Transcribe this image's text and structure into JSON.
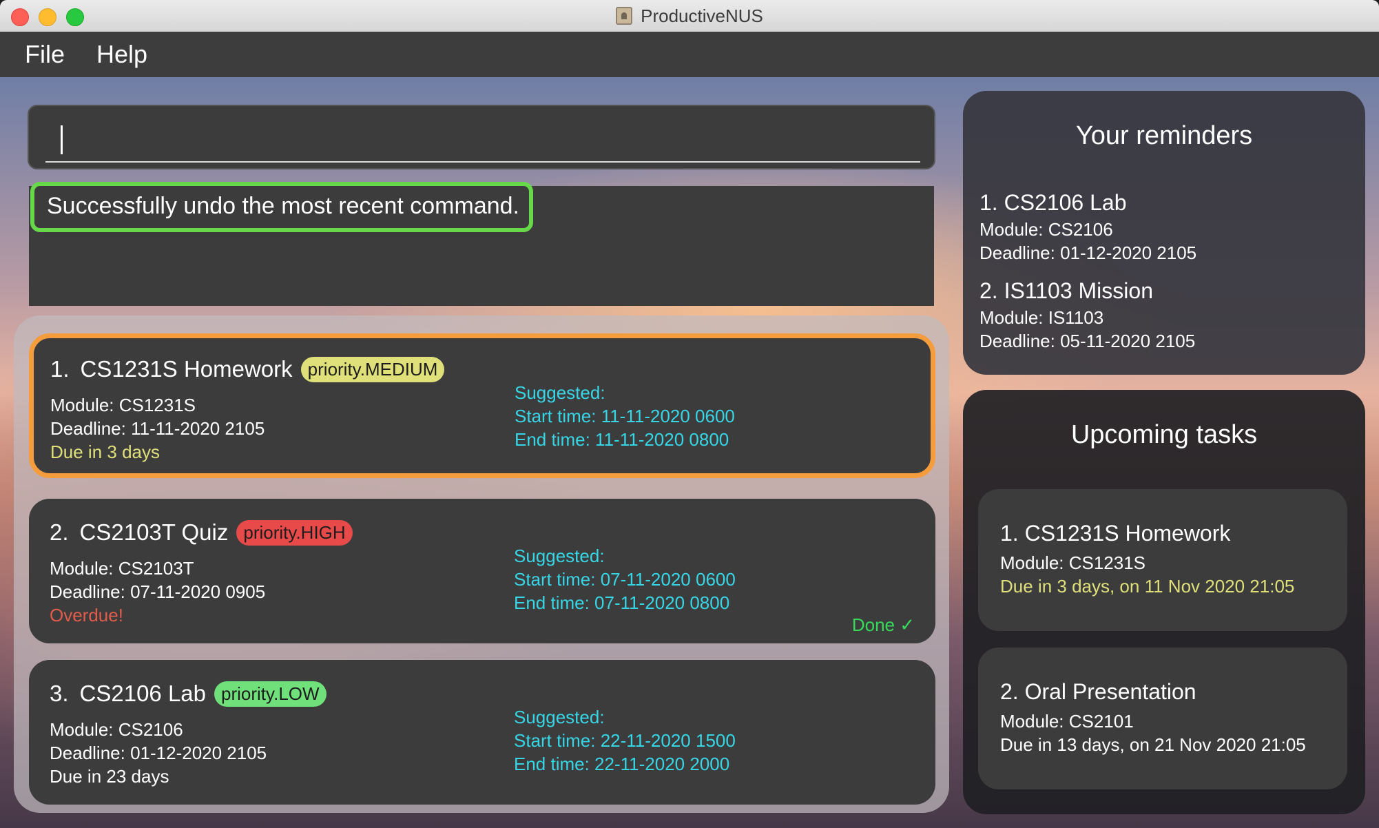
{
  "window": {
    "title": "ProductiveNUS"
  },
  "menu": {
    "file": "File",
    "help": "Help"
  },
  "command": {
    "value": ""
  },
  "result": {
    "message": "Successfully undo the most recent command."
  },
  "tasks": [
    {
      "index": "1.",
      "name": "CS1231S Homework",
      "priority": "priority.MEDIUM",
      "module": "Module: CS1231S",
      "deadline": "Deadline: 11-11-2020 2105",
      "status": "Due in 3 days",
      "suggested": "Suggested:",
      "start": "Start time: 11-11-2020 0600",
      "end": "End time: 11-11-2020 0800"
    },
    {
      "index": "2.",
      "name": "CS2103T Quiz",
      "priority": "priority.HIGH",
      "module": "Module: CS2103T",
      "deadline": "Deadline: 07-11-2020 0905",
      "status": "Overdue!",
      "suggested": "Suggested:",
      "start": "Start time: 07-11-2020 0600",
      "end": "End time: 07-11-2020 0800",
      "done": "Done ✓"
    },
    {
      "index": "3.",
      "name": "CS2106 Lab",
      "priority": "priority.LOW",
      "module": "Module: CS2106",
      "deadline": "Deadline: 01-12-2020 2105",
      "status": "Due in 23 days",
      "suggested": "Suggested:",
      "start": "Start time: 22-11-2020 1500",
      "end": "End time: 22-11-2020 2000"
    }
  ],
  "reminders": {
    "title": "Your reminders",
    "items": [
      {
        "name": "1.  CS2106 Lab",
        "module": "Module: CS2106",
        "deadline": "Deadline: 01-12-2020 2105"
      },
      {
        "name": "2.  IS1103 Mission",
        "module": "Module: IS1103",
        "deadline": "Deadline: 05-11-2020 2105"
      }
    ]
  },
  "upcoming": {
    "title": "Upcoming tasks",
    "items": [
      {
        "name": "1.  CS1231S Homework",
        "module": "Module: CS1231S",
        "due": "Due in 3 days, on 11 Nov 2020 21:05"
      },
      {
        "name": "2.  Oral Presentation",
        "module": "Module: CS2101",
        "due": "Due in 13 days, on 21 Nov 2020 21:05"
      }
    ]
  },
  "colors": {
    "selected_border": "#f59c3c",
    "result_border": "#67d849",
    "suggested_text": "#37d6e6",
    "priority_medium": "#e0e07a",
    "priority_high": "#e84a4a",
    "priority_low": "#6fe07a"
  }
}
